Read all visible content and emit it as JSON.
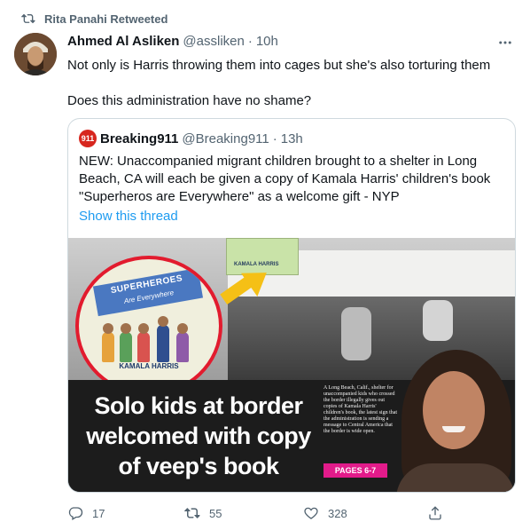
{
  "retweet": {
    "label": "Rita Panahi Retweeted"
  },
  "tweet": {
    "author_name": "Ahmed Al Asliken",
    "author_handle": "@assliken",
    "separator": "·",
    "time": "10h",
    "text_line1": "Not only is Harris throwing them into cages but she's also torturing them",
    "text_line2": "Does this administration have no shame?"
  },
  "quote": {
    "avatar_text": "911",
    "author_name": "Breaking911",
    "author_handle": "@Breaking911",
    "separator": "·",
    "time": "13h",
    "text": "NEW: Unaccompanied migrant children brought to a shelter in Long Beach, CA will each be given a copy of Kamala Harris' children's book \"Superheros are Everywhere\" as a welcome gift  - NYP",
    "show_thread": "Show this thread",
    "image": {
      "book_title": "SUPERHEROES",
      "book_subtitle": "Are Everywhere",
      "book_author": "KAMALA HARRIS",
      "small_book_author": "KAMALA HARRIS",
      "headline": "Solo kids at border welcomed with copy of veep's book",
      "article": "A Long Beach, Calif., shelter for unaccompanied kids who crossed the border illegally gives out copies of Kamala Harris' children's book, the latest sign that the administration is sending a message to Central America that the border is wide open.",
      "pages": "PAGES 6-7"
    }
  },
  "actions": {
    "replies": "17",
    "retweets": "55",
    "likes": "328"
  },
  "icons": {
    "more": "more-horizontal-icon",
    "reply": "reply-icon",
    "retweet": "retweet-icon",
    "like": "heart-icon",
    "share": "share-icon"
  },
  "colors": {
    "link": "#1d9bf0",
    "secondary_text": "#536471",
    "border": "#cfd9de",
    "brand_red": "#d7261e"
  }
}
